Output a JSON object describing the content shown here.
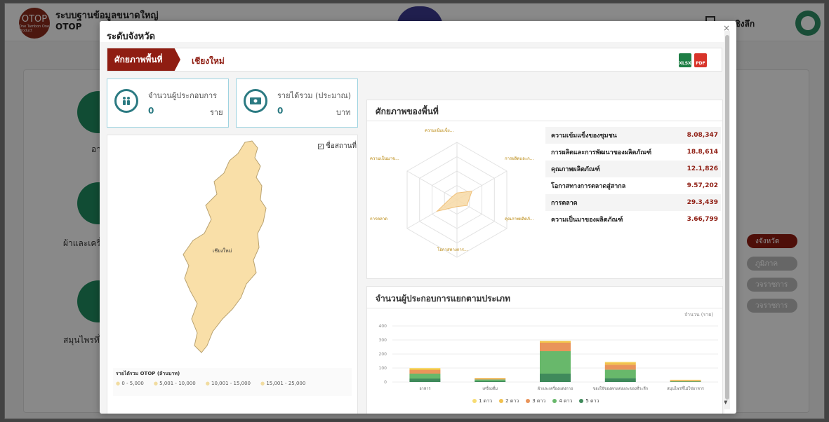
{
  "background": {
    "logo_text": "OTOP",
    "logo_subtext": "One Tambon One Product",
    "title_line1": "ระบบฐานข้อมูลขนาดใหญ่",
    "title_line2": "OTOP",
    "user_text": "ูลเชิงลึก",
    "category_1": "อา",
    "category_2": "ผ้าและเครื่",
    "category_3": "สมุนไพรที่ไ",
    "pills": [
      "งจังหวัด",
      "ภูมิภาค",
      "วจราชการ",
      "วจราชการ"
    ]
  },
  "modal": {
    "title": "ระดับจังหวัด",
    "close": "×",
    "tab_label": "ศักยภาพพื้นที่",
    "province": "เชียงใหม่",
    "export_xlsx": "XLSX",
    "export_pdf": "PDF"
  },
  "stats": {
    "entrepreneurs": {
      "label": "จำนวนผู้ประกอบการ",
      "value": "0",
      "unit": "ราย"
    },
    "revenue": {
      "label": "รายได้รวม (ประมาณ)",
      "value": "0",
      "unit": "บาท"
    }
  },
  "map": {
    "checkbox_label": "ชื่อสถานที่",
    "province_label": "เชียงใหม่",
    "legend_title": "รายได้รวม OTOP (ล้านบาท)",
    "legend_ranges": [
      "0 - 5,000",
      "5,001 - 10,000",
      "10,001 - 15,000",
      "15,001 - 25,000"
    ]
  },
  "potential": {
    "title": "ศักยภาพของพื้นที่",
    "radar_labels": [
      "ความเข้มแข็ง...",
      "การผลิตและก...",
      "คุณภาพผลิตภั...",
      "โอกาสทางการ...",
      "การตลาด",
      "ความเป็นมาข..."
    ],
    "radar_values": [
      0.12,
      0.3,
      0.2,
      0.12,
      0.4,
      0.1
    ],
    "rows": [
      {
        "name": "ความเข้มแข็งของชุมชน",
        "value": "8.08,347"
      },
      {
        "name": "การผลิตและการพัฒนาของผลิตภัณฑ์",
        "value": "18.8,614"
      },
      {
        "name": "คุณภาพผลิตภัณฑ์",
        "value": "12.1,826"
      },
      {
        "name": "โอกาสทางการตลาดสู่สากล",
        "value": "9.57,202"
      },
      {
        "name": "การตลาด",
        "value": "29.3,439"
      },
      {
        "name": "ความเป็นมาของผลิตภัณฑ์",
        "value": "3.66,799"
      }
    ]
  },
  "bar_section": {
    "title": "จำนวนผู้ประกอบการแยกตามประเภท",
    "unit_label": "จำนวน (ราย)"
  },
  "chart_data": {
    "type": "bar",
    "stacked": true,
    "categories": [
      "อาหาร",
      "เครื่องดื่ม",
      "ผ้าและเครื่องแต่งกาย",
      "ของใช้ของตกแต่งและของที่ระลึก",
      "สมุนไพรที่ไม่ใช่อาหาร"
    ],
    "ylim": [
      0,
      400
    ],
    "yticks": [
      0,
      100,
      200,
      300,
      400
    ],
    "grid": true,
    "legend_position": "bottom",
    "series": [
      {
        "name": "5 ดาว",
        "color": "#3f8a5b",
        "values": [
          25,
          8,
          60,
          28,
          2
        ]
      },
      {
        "name": "4 ดาว",
        "color": "#68b86b",
        "values": [
          35,
          10,
          160,
          60,
          4
        ]
      },
      {
        "name": "3 ดาว",
        "color": "#e9945a",
        "values": [
          25,
          6,
          60,
          35,
          4
        ]
      },
      {
        "name": "2 ดาว",
        "color": "#f2c14e",
        "values": [
          10,
          4,
          10,
          15,
          4
        ]
      },
      {
        "name": "1 ดาว",
        "color": "#f7dc73",
        "values": [
          5,
          2,
          5,
          7,
          2
        ]
      }
    ],
    "legend_order": [
      "1 ดาว",
      "2 ดาว",
      "3 ดาว",
      "4 ดาว",
      "5 ดาว"
    ]
  }
}
